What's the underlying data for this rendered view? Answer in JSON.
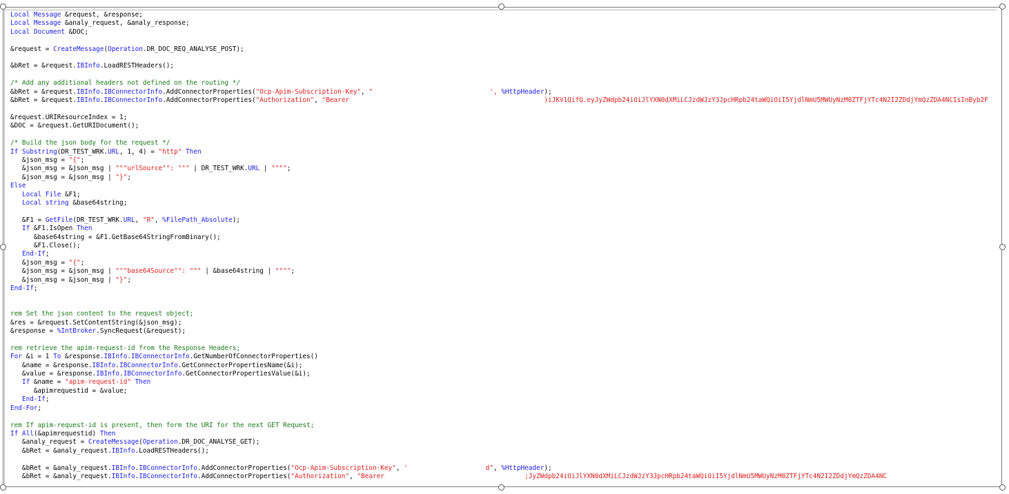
{
  "lines": [
    [
      [
        "kw",
        "Local Message"
      ],
      [
        "t",
        " &request, &response;"
      ]
    ],
    [
      [
        "kw",
        "Local Message"
      ],
      [
        "t",
        " &analy_request, &analy_response;"
      ]
    ],
    [
      [
        "kw",
        "Local Document"
      ],
      [
        "t",
        " &DOC;"
      ]
    ],
    [],
    [
      [
        "t",
        "&request = "
      ],
      [
        "kw",
        "CreateMessage"
      ],
      [
        "t",
        "("
      ],
      [
        "kw",
        "Operation"
      ],
      [
        "t",
        ".DR_DOC_REQ_ANALYSE_POST);"
      ]
    ],
    [],
    [
      [
        "t",
        "&bRet = &request."
      ],
      [
        "kw",
        "IBInfo"
      ],
      [
        "t",
        ".LoadRESTHeaders();"
      ]
    ],
    [],
    [
      [
        "cm",
        "/* Add any additional headers not defined on the routing */"
      ]
    ],
    [
      [
        "t",
        "&bRet = &request."
      ],
      [
        "kw",
        "IBInfo"
      ],
      [
        "t",
        "."
      ],
      [
        "kw",
        "IBConnectorInfo"
      ],
      [
        "t",
        ".AddConnectorProperties("
      ],
      [
        "str",
        "\"Ocp-Apim-Subscription-Key\""
      ],
      [
        "t",
        ", "
      ],
      [
        "str",
        "\"                              "
      ],
      [
        "str",
        "', "
      ],
      [
        "kw",
        "%HttpHeader"
      ],
      [
        "t",
        ");"
      ]
    ],
    [
      [
        "t",
        "&bRet = &request."
      ],
      [
        "kw",
        "IBInfo"
      ],
      [
        "t",
        "."
      ],
      [
        "kw",
        "IBConnectorInfo"
      ],
      [
        "t",
        ".AddConnectorProperties("
      ],
      [
        "str",
        "\"Authorization\""
      ],
      [
        "t",
        ", "
      ],
      [
        "str",
        "\"Bearer "
      ],
      [
        "str",
        "                                                 )iJKV1QifQ.eyJyZWdpb24iOiJlYXN0dXMiLCJzdWJzY3JpcHRpb24taWQiOiI5YjdlNmU5MWUyNzM0ZTFjYTc4N2I2ZDdjYmQzZDA4NCIsInByb2F"
      ]
    ],
    [],
    [
      [
        "t",
        "&request.URIResourceIndex = 1;"
      ]
    ],
    [
      [
        "t",
        "&DOC = &request.GetURIDocument();"
      ]
    ],
    [],
    [
      [
        "cm",
        "/* Build the json body for the request */"
      ]
    ],
    [
      [
        "kw",
        "If Substring"
      ],
      [
        "t",
        "(DR_TEST_WRK."
      ],
      [
        "kw",
        "URL"
      ],
      [
        "t",
        ", 1, 4) = "
      ],
      [
        "str",
        "\"http\""
      ],
      [
        "t",
        " "
      ],
      [
        "kw",
        "Then"
      ]
    ],
    [
      [
        "t",
        "   &json_msg = "
      ],
      [
        "str",
        "\"{\""
      ],
      [
        "t",
        ";"
      ]
    ],
    [
      [
        "t",
        "   &json_msg = &json_msg | "
      ],
      [
        "str",
        "\"\"\"urlSource\"\": \"\"\""
      ],
      [
        "t",
        " | DR_TEST_WRK."
      ],
      [
        "kw",
        "URL"
      ],
      [
        "t",
        " | "
      ],
      [
        "str",
        "\"\"\"\""
      ],
      [
        "t",
        ";"
      ]
    ],
    [
      [
        "t",
        "   &json_msg = &json_msg | "
      ],
      [
        "str",
        "\"}\""
      ],
      [
        "t",
        ";"
      ]
    ],
    [
      [
        "kw",
        "Else"
      ]
    ],
    [
      [
        "t",
        "   "
      ],
      [
        "kw",
        "Local File"
      ],
      [
        "t",
        " &F1;"
      ]
    ],
    [
      [
        "t",
        "   "
      ],
      [
        "kw",
        "Local string"
      ],
      [
        "t",
        " &base64string;"
      ]
    ],
    [],
    [
      [
        "t",
        "   &F1 = "
      ],
      [
        "kw",
        "GetFile"
      ],
      [
        "t",
        "(DR_TEST_WRK."
      ],
      [
        "kw",
        "URL"
      ],
      [
        "t",
        ", "
      ],
      [
        "str",
        "\"R\""
      ],
      [
        "t",
        ", "
      ],
      [
        "kw",
        "%FilePath_Absolute"
      ],
      [
        "t",
        ");"
      ]
    ],
    [
      [
        "t",
        "   "
      ],
      [
        "kw",
        "If"
      ],
      [
        "t",
        " &F1.IsOpen "
      ],
      [
        "kw",
        "Then"
      ]
    ],
    [
      [
        "t",
        "      &base64string = &F1.GetBase64StringFromBinary();"
      ]
    ],
    [
      [
        "t",
        "      &F1.Close();"
      ]
    ],
    [
      [
        "t",
        "   "
      ],
      [
        "kw",
        "End-If"
      ],
      [
        "t",
        ";"
      ]
    ],
    [
      [
        "t",
        "   &json_msg = "
      ],
      [
        "str",
        "\"{\""
      ],
      [
        "t",
        ";"
      ]
    ],
    [
      [
        "t",
        "   &json_msg = &json_msg | "
      ],
      [
        "str",
        "\"\"\"base64Source\"\": \"\"\""
      ],
      [
        "t",
        " | &base64string | "
      ],
      [
        "str",
        "\"\"\"\""
      ],
      [
        "t",
        ";"
      ]
    ],
    [
      [
        "t",
        "   &json_msg = &json_msg | "
      ],
      [
        "str",
        "\"}\""
      ],
      [
        "t",
        ";"
      ]
    ],
    [
      [
        "kw",
        "End-If"
      ],
      [
        "t",
        ";"
      ]
    ],
    [],
    [],
    [
      [
        "cm",
        "rem Set the json content to the request object;"
      ]
    ],
    [
      [
        "t",
        "&res = &request.SetContentString(&json_msg);"
      ]
    ],
    [
      [
        "t",
        "&response = "
      ],
      [
        "kw",
        "%IntBroker"
      ],
      [
        "t",
        ".SyncRequest(&request);"
      ]
    ],
    [],
    [
      [
        "cm",
        "rem retrieve the apim-request-id from the Response Headers;"
      ]
    ],
    [
      [
        "kw",
        "For"
      ],
      [
        "t",
        " &i = 1 "
      ],
      [
        "kw",
        "To"
      ],
      [
        "t",
        " &response."
      ],
      [
        "kw",
        "IBInfo"
      ],
      [
        "t",
        "."
      ],
      [
        "kw",
        "IBConnectorInfo"
      ],
      [
        "t",
        ".GetNumberOfConnectorProperties()"
      ]
    ],
    [
      [
        "t",
        "   &name = &response."
      ],
      [
        "kw",
        "IBInfo"
      ],
      [
        "t",
        "."
      ],
      [
        "kw",
        "IBConnectorInfo"
      ],
      [
        "t",
        ".GetConnectorPropertiesName(&i);"
      ]
    ],
    [
      [
        "t",
        "   &value = &response."
      ],
      [
        "kw",
        "IBInfo"
      ],
      [
        "t",
        "."
      ],
      [
        "kw",
        "IBConnectorInfo"
      ],
      [
        "t",
        ".GetConnectorPropertiesValue(&i);"
      ]
    ],
    [
      [
        "t",
        "   "
      ],
      [
        "kw",
        "If"
      ],
      [
        "t",
        " &name = "
      ],
      [
        "str",
        "\"apim-request-id\""
      ],
      [
        "t",
        " "
      ],
      [
        "kw",
        "Then"
      ]
    ],
    [
      [
        "t",
        "      &apimrequestid = &value;"
      ]
    ],
    [
      [
        "t",
        "   "
      ],
      [
        "kw",
        "End-If"
      ],
      [
        "t",
        ";"
      ]
    ],
    [
      [
        "kw",
        "End-For"
      ],
      [
        "t",
        ";"
      ]
    ],
    [],
    [
      [
        "cm",
        "rem If apim-request-id is present, then form the URI for the next GET Request;"
      ]
    ],
    [
      [
        "kw",
        "If All"
      ],
      [
        "t",
        "(&apimrequestid) "
      ],
      [
        "kw",
        "Then"
      ]
    ],
    [
      [
        "t",
        "   &analy_request = "
      ],
      [
        "kw",
        "CreateMessage"
      ],
      [
        "t",
        "("
      ],
      [
        "kw",
        "Operation"
      ],
      [
        "t",
        ".DR_DOC_ANALYSE_GET);"
      ]
    ],
    [
      [
        "t",
        "   &bRet = &analy_request."
      ],
      [
        "kw",
        "IBInfo"
      ],
      [
        "t",
        ".LoadRESTHeaders();"
      ]
    ],
    [],
    [
      [
        "t",
        "   &bRet = &analy_request."
      ],
      [
        "kw",
        "IBInfo"
      ],
      [
        "t",
        "."
      ],
      [
        "kw",
        "IBConnectorInfo"
      ],
      [
        "t",
        ".AddConnectorProperties("
      ],
      [
        "str",
        "\"Ocp-Apim-Subscription-Key\""
      ],
      [
        "t",
        ", "
      ],
      [
        "str",
        "'                    d\""
      ],
      [
        "t",
        ", "
      ],
      [
        "kw",
        "%HttpHeader"
      ],
      [
        "t",
        ");"
      ]
    ],
    [
      [
        "t",
        "   &bRet = &analy_request."
      ],
      [
        "kw",
        "IBInfo"
      ],
      [
        "t",
        "."
      ],
      [
        "kw",
        "IBConnectorInfo"
      ],
      [
        "t",
        ".AddConnectorProperties("
      ],
      [
        "str",
        "\"Authorization\""
      ],
      [
        "t",
        ", "
      ],
      [
        "str",
        "\"Bearer "
      ],
      [
        "str",
        "                                   ;JyZWdpb24iOiJlYXN0dXMiLCJzdWJzY3JpcHRpb24taWQiOiI5YjdlNmU5MWUyNzM0ZTFjYTc4N2I2ZDdjYmQzZDA4NC"
      ]
    ]
  ]
}
